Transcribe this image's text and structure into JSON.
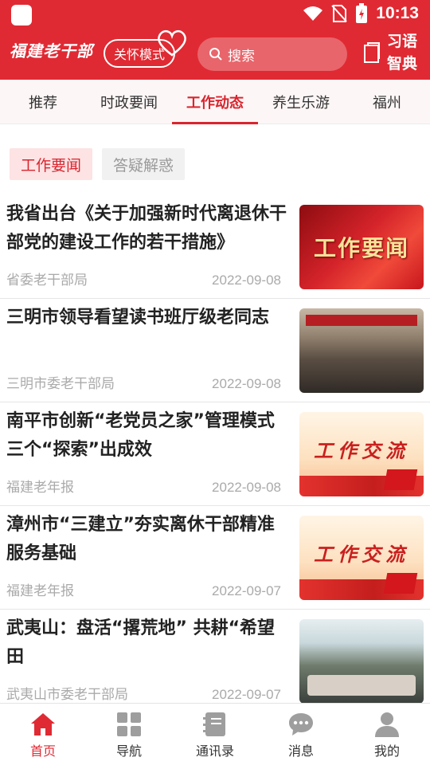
{
  "status": {
    "time": "10:13"
  },
  "header": {
    "logo": "福建老干部",
    "care_mode": "关怀模式",
    "search_placeholder": "搜索",
    "dict_label": "习语智典"
  },
  "tabs": [
    {
      "label": "推荐",
      "active": false
    },
    {
      "label": "时政要闻",
      "active": false
    },
    {
      "label": "工作动态",
      "active": true
    },
    {
      "label": "养生乐游",
      "active": false
    },
    {
      "label": "福州",
      "active": false
    }
  ],
  "chips": [
    {
      "label": "工作要闻",
      "active": true
    },
    {
      "label": "答疑解惑",
      "active": false
    }
  ],
  "news": [
    {
      "title": "我省出台《关于加强新时代离退休干部党的建设工作的若干措施》",
      "source": "省委老干部局",
      "date": "2022-09-08",
      "thumb_text": "工作要闻"
    },
    {
      "title": "三明市领导看望读书班厅级老同志",
      "source": "三明市委老干部局",
      "date": "2022-09-08",
      "thumb_text": ""
    },
    {
      "title": "南平市创新“老党员之家”管理模式三个“探索”出成效",
      "source": "福建老年报",
      "date": "2022-09-08",
      "thumb_text": "工作交流"
    },
    {
      "title": "漳州市“三建立”夯实离休干部精准服务基础",
      "source": "福建老年报",
      "date": "2022-09-07",
      "thumb_text": "工作交流"
    },
    {
      "title": "武夷山：盘活“撂荒地” 共耕“希望田",
      "source": "武夷山市委老干部局",
      "date": "2022-09-07",
      "thumb_text": ""
    }
  ],
  "bottom_nav": [
    {
      "label": "首页",
      "icon": "home-icon",
      "active": true
    },
    {
      "label": "导航",
      "icon": "grid-icon",
      "active": false
    },
    {
      "label": "通讯录",
      "icon": "contacts-icon",
      "active": false
    },
    {
      "label": "消息",
      "icon": "chat-icon",
      "active": false
    },
    {
      "label": "我的",
      "icon": "user-icon",
      "active": false
    }
  ],
  "colors": {
    "brand": "#e02a33",
    "active_text": "#d9252e"
  }
}
